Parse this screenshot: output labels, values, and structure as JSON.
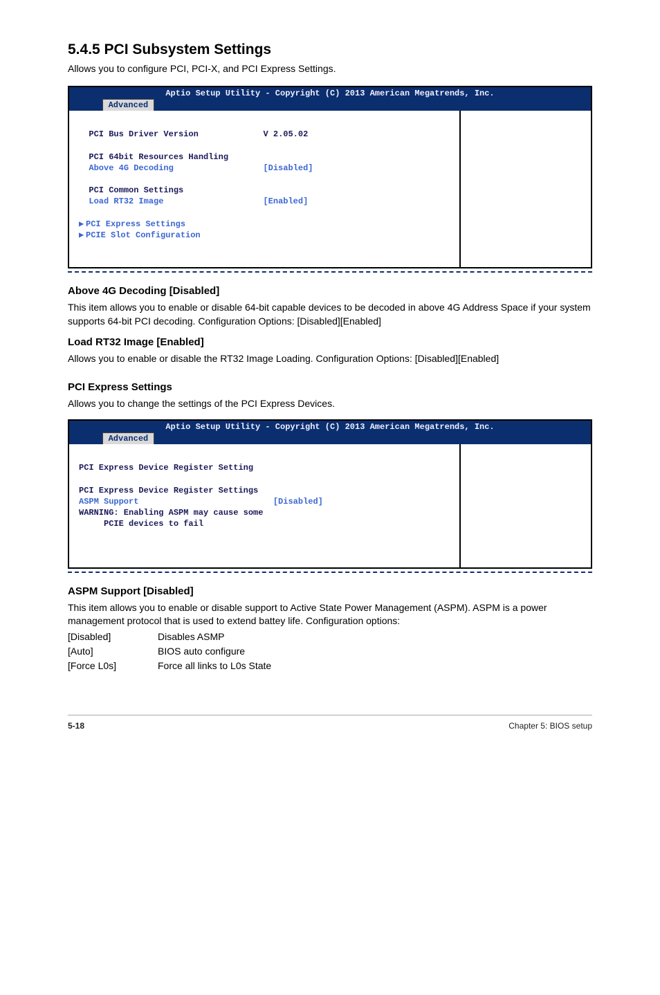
{
  "section": {
    "number_title": "5.4.5 PCI Subsystem Settings",
    "intro": "Allows you to configure PCI, PCI-X, and PCI Express Settings."
  },
  "bios1": {
    "title": "Aptio Setup Utility - Copyright (C) 2013 American Megatrends, Inc.",
    "tab": "Advanced",
    "rows": {
      "r1_label": "PCI Bus Driver Version",
      "r1_val": "V 2.05.02",
      "r2_label": "PCI 64bit Resources Handling",
      "r3_label": "Above 4G Decoding",
      "r3_val": "[Disabled]",
      "r4_label": "PCI Common Settings",
      "r5_label": "Load RT32 Image",
      "r5_val": "[Enabled]",
      "r6_label": "PCI Express Settings",
      "r7_label": "PCIE Slot Configuration"
    }
  },
  "above4g": {
    "heading": "Above 4G Decoding [Disabled]",
    "body": "This item allows you to enable or disable 64-bit capable devices to be decoded in above 4G Address Space if your system supports 64-bit PCI decoding. Configuration Options: [Disabled][Enabled]"
  },
  "loadrt32": {
    "heading": "Load RT32 Image [Enabled]",
    "body": "Allows you to enable or disable the RT32 Image Loading. Configuration Options: [Disabled][Enabled]"
  },
  "pciexpress": {
    "heading": "PCI Express Settings",
    "body": "Allows you to change the settings of the PCI Express Devices."
  },
  "bios2": {
    "title": "Aptio Setup Utility - Copyright (C) 2013 American Megatrends, Inc.",
    "tab": "Advanced",
    "rows": {
      "r1": "PCI Express Device Register Setting",
      "r2": "PCI Express Device Register Settings",
      "r3_label": "ASPM Support",
      "r3_val": "[Disabled]",
      "r4": "WARNING: Enabling ASPM may cause some",
      "r5": "     PCIE devices to fail"
    }
  },
  "aspm": {
    "heading": "ASPM Support [Disabled]",
    "body": "This item allows you to enable or disable support to Active State Power Management (ASPM). ASPM is a power management protocol that is used to extend battey life. Configuration options:",
    "opts": [
      {
        "k": "[Disabled]",
        "v": "Disables ASMP"
      },
      {
        "k": "[Auto]",
        "v": "BIOS auto configure"
      },
      {
        "k": "[Force L0s]",
        "v": "Force all links to L0s State"
      }
    ]
  },
  "footer": {
    "left": "5-18",
    "right": "Chapter 5: BIOS setup"
  }
}
